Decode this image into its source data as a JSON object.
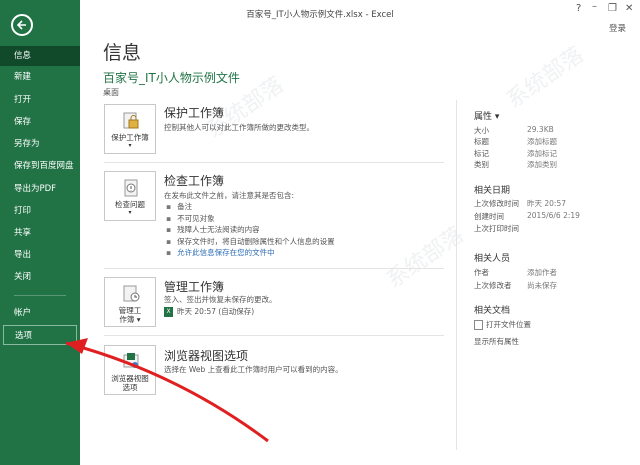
{
  "window": {
    "title": "百家号_IT小人物示例文件.xlsx - Excel",
    "help": "?",
    "signin": "登录"
  },
  "nav": {
    "items": [
      "信息",
      "新建",
      "打开",
      "保存",
      "另存为",
      "保存到百度网盘",
      "导出为PDF",
      "打印",
      "共享",
      "导出",
      "关闭"
    ],
    "bottom": [
      "帐户",
      "选项"
    ]
  },
  "main": {
    "title": "信息",
    "file_name": "百家号_IT小人物示例文件",
    "file_location": "桌面",
    "protect": {
      "button": "保护工作簿",
      "title": "保护工作簿",
      "desc": "控制其他人可以对此工作簿所做的更改类型。"
    },
    "inspect": {
      "button": "检查问题",
      "title": "检查工作簿",
      "desc": "在发布此文件之前，请注意其是否包含:",
      "bullets": [
        "备注",
        "不可见对象",
        "残障人士无法阅读的内容",
        "保存文件时，将自动删除属性和个人信息的设置"
      ],
      "link": "允许此信息保存在您的文件中"
    },
    "manage": {
      "button_line1": "管理工",
      "button_line2": "作簿",
      "title": "管理工作簿",
      "desc": "签入、签出并恢复未保存的更改。",
      "autosave": "昨天 20:57 (自动保存)"
    },
    "browser": {
      "button_line1": "浏览器视图",
      "button_line2": "选项",
      "title": "浏览器视图选项",
      "desc": "选择在 Web 上查看此工作簿时用户可以看到的内容。"
    }
  },
  "properties": {
    "heading": "属性",
    "rows": [
      {
        "k": "大小",
        "v": "29.3KB"
      },
      {
        "k": "标题",
        "v": "添加标题"
      },
      {
        "k": "标记",
        "v": "添加标记"
      },
      {
        "k": "类别",
        "v": "添加类别"
      }
    ],
    "dates_heading": "相关日期",
    "dates": [
      {
        "k": "上次修改时间",
        "v": "昨天 20:57"
      },
      {
        "k": "创建时间",
        "v": "2015/6/6 2:19"
      },
      {
        "k": "上次打印时间",
        "v": ""
      }
    ],
    "people_heading": "相关人员",
    "people": [
      {
        "k": "作者",
        "v": "添加作者"
      },
      {
        "k": "上次修改者",
        "v": "尚未保存"
      }
    ],
    "docs_heading": "相关文档",
    "open_location": "打开文件位置",
    "show_all": "显示所有属性"
  },
  "colors": {
    "nav_bg": "#217346",
    "nav_active": "#114a2b",
    "accent": "#217346",
    "annotation": "#e02020"
  }
}
